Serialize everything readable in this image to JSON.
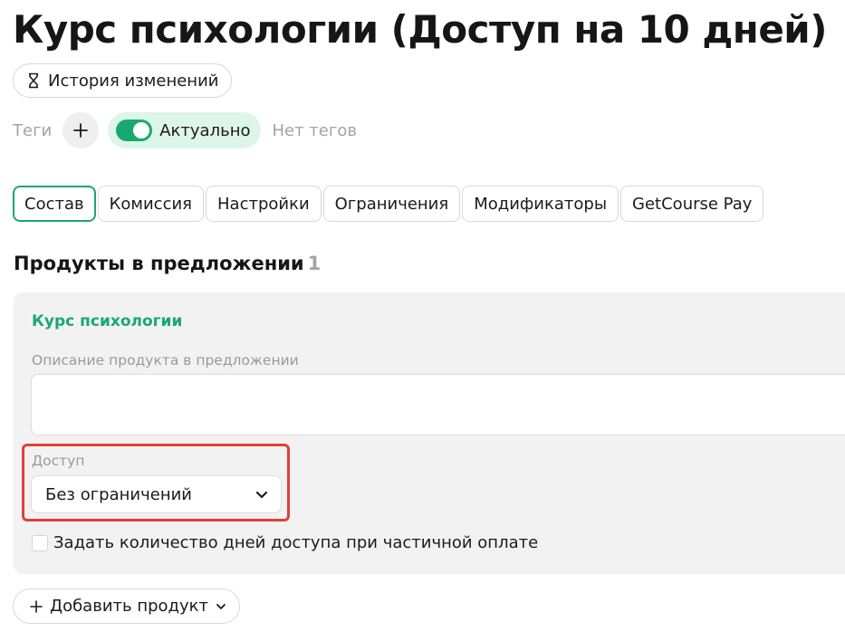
{
  "header": {
    "title": "Курс психологии (Доступ на 10 дней)",
    "history_button_label": "История изменений",
    "history_icon": "hourglass-icon"
  },
  "tags": {
    "label": "Теги",
    "add_icon": "plus-icon",
    "toggle_label": "Актуально",
    "toggle_on": true,
    "empty_text": "Нет тегов"
  },
  "tabs": [
    {
      "label": "Состав",
      "active": true
    },
    {
      "label": "Комиссия",
      "active": false
    },
    {
      "label": "Настройки",
      "active": false
    },
    {
      "label": "Ограничения",
      "active": false
    },
    {
      "label": "Модификаторы",
      "active": false
    },
    {
      "label": "GetCourse Pay",
      "active": false
    }
  ],
  "products": {
    "section_title": "Продукты в предложении",
    "count": "1",
    "items": [
      {
        "name": "Курс психологии",
        "description_label": "Описание продукта в предложении",
        "description_value": "",
        "access_label": "Доступ",
        "access_value": "Без ограничений",
        "days_checkbox_label": "Задать количество дней доступа при частичной оплате",
        "days_checkbox_checked": false
      }
    ],
    "add_button_label": "Добавить продукт"
  },
  "colors": {
    "accent": "#1aa872",
    "accent_bg": "#def5ea",
    "highlight": "#e0403a",
    "card_bg": "#f2f2f2"
  }
}
